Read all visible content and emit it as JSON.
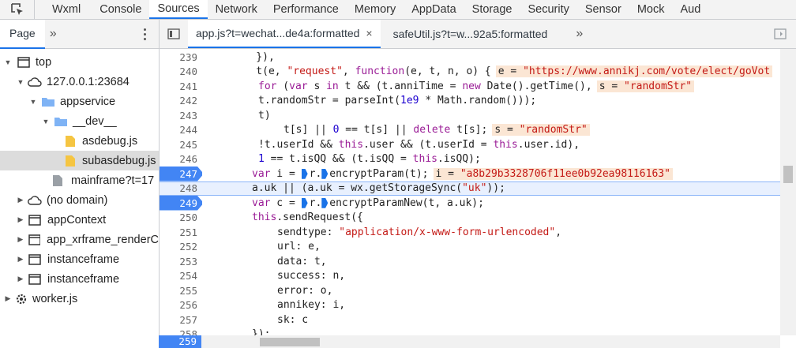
{
  "tabs": [
    "Wxml",
    "Console",
    "Sources",
    "Network",
    "Performance",
    "Memory",
    "AppData",
    "Storage",
    "Security",
    "Sensor",
    "Mock",
    "Aud"
  ],
  "left_panel": {
    "tab": "Page",
    "more": "»"
  },
  "editor_tabs": [
    {
      "label": "app.js?t=wechat...de4a:formatted",
      "close": "×"
    },
    {
      "label": "safeUtil.js?t=w...92a5:formatted"
    }
  ],
  "editor_more": "»",
  "tree": {
    "top": "top",
    "host": "127.0.0.1:23684",
    "appservice": "appservice",
    "dev": "__dev__",
    "asdebug": "asdebug.js",
    "subasdebug": "subasdebug.js",
    "mainframe": "mainframe?t=17",
    "nodomain": "(no domain)",
    "appcontext": "appContext",
    "xrframe": "app_xrframe_renderC",
    "instance1": "instanceframe",
    "instance2": "instanceframe",
    "worker": "worker.js"
  },
  "lines": {
    "239": "239",
    "240": "240",
    "241": "241",
    "242": "242",
    "243": "243",
    "244": "244",
    "245": "245",
    "246": "246",
    "247": "247",
    "248": "248",
    "249": "249",
    "250": "250",
    "251": "251",
    "252": "252",
    "253": "253",
    "254": "254",
    "255": "255",
    "256": "256",
    "257": "257",
    "258": "258",
    "259": "259"
  },
  "code": {
    "l239": "    }),",
    "l240a": "    t(e, ",
    "l240s": "\"request\"",
    "l240b": ", ",
    "l240kw": "function",
    "l240c": "(e, t, n, o) {",
    "l240i_k": "e = ",
    "l240i_v": "\"https://www.annikj.com/vote/elect/goVot",
    "l241kw1": "for",
    "l241a": " (",
    "l241kw2": "var",
    "l241b": " s ",
    "l241kw3": "in",
    "l241c": " t && (t.anniTime = ",
    "l241kw4": "new",
    "l241d": " Date().getTime(),",
    "l241i_k": "s = ",
    "l241i_v": "\"randomStr\"",
    "l242a": "t.randomStr = parseInt(",
    "l242n1": "1e9",
    "l242b": " * Math.random()));",
    "l243": "t)",
    "l244a": "t[s] || ",
    "l244n": "0",
    "l244b": " == t[s] || ",
    "l244kw": "delete",
    "l244c": " t[s];",
    "l244i_k": "s = ",
    "l244i_v": "\"randomStr\"",
    "l245a": "!t.userId && ",
    "l245kw1": "this",
    "l245b": ".user && (t.userId = ",
    "l245kw2": "this",
    "l245c": ".user.id),",
    "l246n": "1",
    "l246a": " == t.isQQ && (t.isQQ = ",
    "l246kw": "this",
    "l246b": ".isQQ);",
    "l247kw": "var",
    "l247a": " i = ",
    "l247b": "r.",
    "l247c": "encryptParam(t);",
    "l247i_k": "i = ",
    "l247i_v": "\"a8b29b3328706f11ee0b92ea98116163\"",
    "l248a": "a.uk || (a.uk = wx.getStorageSync(",
    "l248s": "\"uk\"",
    "l248b": "));",
    "l249kw": "var",
    "l249a": " c = ",
    "l249b": "r.",
    "l249c": "encryptParamNew(t, a.uk);",
    "l250kw": "this",
    "l250a": ".sendRequest({",
    "l251a": "sendtype: ",
    "l251s": "\"application/x-www-form-urlencoded\"",
    "l251b": ",",
    "l252": "url: e,",
    "l253": "data: t,",
    "l254": "success: n,",
    "l255": "error: o,",
    "l256": "annikey: i,",
    "l257": "sk: c",
    "l258": "});"
  }
}
